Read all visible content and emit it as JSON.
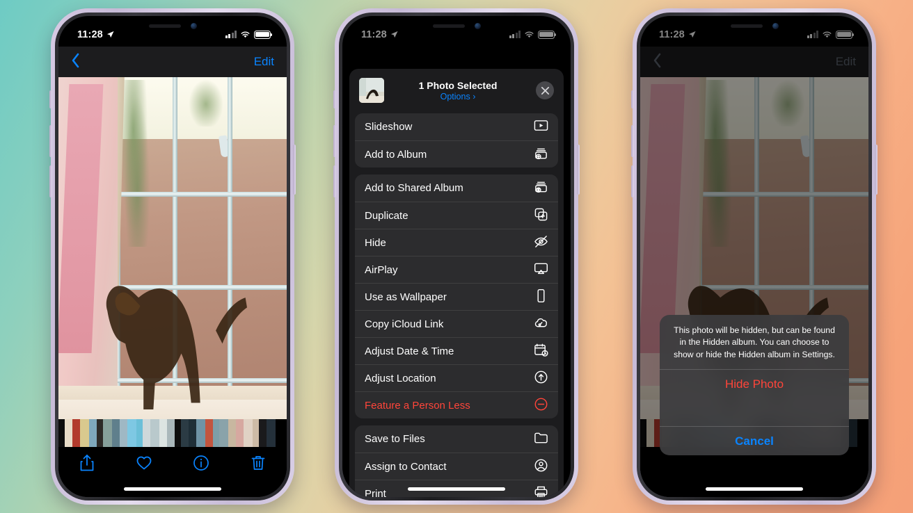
{
  "background": {
    "gradient_start": "#6ecbc4",
    "gradient_mid": "#e3cfa5",
    "gradient_end": "#f5a078"
  },
  "colors": {
    "accent_blue": "#0a84ff",
    "destructive_red": "#ff453a",
    "sheet_bg": "#1c1c1e",
    "group_bg": "#2c2c2e"
  },
  "status_bar": {
    "time": "11:28",
    "location_icon": "location-arrow-icon",
    "cellular_icon": "cellular-bars-icon",
    "wifi_icon": "wifi-icon",
    "battery_icon": "battery-icon"
  },
  "phone1": {
    "nav": {
      "back_icon": "chevron-left-icon",
      "edit_label": "Edit"
    },
    "photo": {
      "alt": "bronze dog statue on pedestal by a window"
    },
    "toolbar": [
      {
        "name": "share-button",
        "icon": "share-icon"
      },
      {
        "name": "favorite-button",
        "icon": "heart-icon"
      },
      {
        "name": "info-button",
        "icon": "info-icon"
      },
      {
        "name": "delete-button",
        "icon": "trash-icon"
      }
    ]
  },
  "phone2": {
    "share_sheet": {
      "title": "1 Photo Selected",
      "options_label": "Options",
      "options_chevron": "›",
      "close_icon": "close-icon",
      "groups": [
        {
          "items": [
            {
              "label": "Slideshow",
              "icon": "slideshow-icon",
              "destructive": false
            },
            {
              "label": "Add to Album",
              "icon": "add-to-album-icon",
              "destructive": false
            }
          ]
        },
        {
          "items": [
            {
              "label": "Add to Shared Album",
              "icon": "shared-album-icon",
              "destructive": false
            },
            {
              "label": "Duplicate",
              "icon": "duplicate-icon",
              "destructive": false
            },
            {
              "label": "Hide",
              "icon": "hide-eye-icon",
              "destructive": false
            },
            {
              "label": "AirPlay",
              "icon": "airplay-icon",
              "destructive": false
            },
            {
              "label": "Use as Wallpaper",
              "icon": "wallpaper-icon",
              "destructive": false
            },
            {
              "label": "Copy iCloud Link",
              "icon": "icloud-link-icon",
              "destructive": false
            },
            {
              "label": "Adjust Date & Time",
              "icon": "calendar-clock-icon",
              "destructive": false
            },
            {
              "label": "Adjust Location",
              "icon": "location-circle-icon",
              "destructive": false
            },
            {
              "label": "Feature a Person Less",
              "icon": "minus-circle-icon",
              "destructive": true
            }
          ]
        },
        {
          "items": [
            {
              "label": "Save to Files",
              "icon": "folder-icon",
              "destructive": false
            },
            {
              "label": "Assign to Contact",
              "icon": "contact-icon",
              "destructive": false
            },
            {
              "label": "Print",
              "icon": "printer-icon",
              "destructive": false
            }
          ]
        }
      ]
    }
  },
  "phone3": {
    "nav": {
      "back_icon": "chevron-left-icon",
      "edit_label": "Edit"
    },
    "alert": {
      "message": "This photo will be hidden, but can be found in the Hidden album. You can choose to show or hide the Hidden album in Settings.",
      "confirm_label": "Hide Photo",
      "cancel_label": "Cancel"
    }
  },
  "thumbnails": [
    "#0d0d0d",
    "#e8dcc8",
    "#b23a2c",
    "#d9c98e",
    "#7fa8bc",
    "#2d2a27",
    "#86a09a",
    "#5f7f8c",
    "#9fb8c4",
    "#7ec8e3",
    "#6bbfd8",
    "#cfd8da",
    "#b9c9cc",
    "#dce4e2",
    "#aab8bb",
    "#0e0e0e",
    "#2b3b44",
    "#1f2f38",
    "#6f94a6",
    "#c2553f",
    "#7d9fa8",
    "#8aa3aa",
    "#c8b7a0",
    "#d6a8a0",
    "#e0d2c4",
    "#cdbba6",
    "#1a1a1c",
    "#24303a"
  ]
}
